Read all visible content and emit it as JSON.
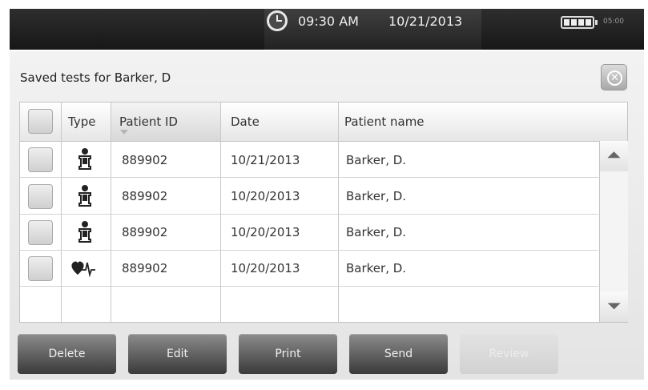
{
  "status_bar": {
    "time": "09:30 AM",
    "date": "10/21/2013",
    "battery_time": "05:00"
  },
  "dialog": {
    "title": "Saved tests for Barker, D",
    "close_icon": "circle-x-icon"
  },
  "table": {
    "columns": [
      "Type",
      "Patient ID",
      "Date",
      "Patient name"
    ],
    "sorted_column": "Patient ID",
    "rows": [
      {
        "type_icon": "person-icon",
        "patient_id": "889902",
        "date": "10/21/2013",
        "patient_name": "Barker, D."
      },
      {
        "type_icon": "person-icon",
        "patient_id": "889902",
        "date": "10/20/2013",
        "patient_name": "Barker, D."
      },
      {
        "type_icon": "person-icon",
        "patient_id": "889902",
        "date": "10/20/2013",
        "patient_name": "Barker, D."
      },
      {
        "type_icon": "heart-ecg-icon",
        "patient_id": "889902",
        "date": "10/20/2013",
        "patient_name": "Barker, D."
      }
    ]
  },
  "buttons": {
    "delete": "Delete",
    "edit": "Edit",
    "print": "Print",
    "send": "Send",
    "review": "Review"
  },
  "colors": {
    "top_bar": "#1c1c1c",
    "button": "#5a5a5a",
    "button_disabled": "#dadada"
  }
}
